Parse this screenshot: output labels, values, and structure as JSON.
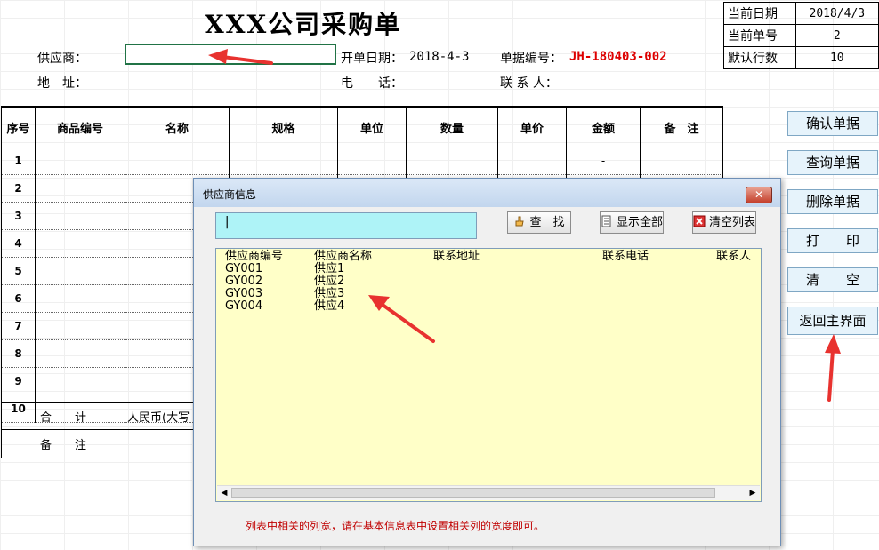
{
  "form": {
    "title": "XXX公司采购单",
    "supplier_label": "供应商：",
    "address_label": "地　址：",
    "date_label": "开单日期：",
    "date_value": "2018-4-3",
    "phone_label": "电　　话：",
    "orderno_label": "单据编号：",
    "orderno_value": "JH-180403-002",
    "contact_label": "联 系 人："
  },
  "info": [
    {
      "k": "当前日期",
      "v": "2018/4/3"
    },
    {
      "k": "当前单号",
      "v": "2"
    },
    {
      "k": "默认行数",
      "v": "10"
    }
  ],
  "table": {
    "headers": [
      "序号",
      "商品编号",
      "名称",
      "规格",
      "单位",
      "数量",
      "单价",
      "金额",
      "备　注"
    ],
    "rows": [
      "1",
      "2",
      "3",
      "4",
      "5",
      "6",
      "7",
      "8",
      "9",
      "10"
    ],
    "first_amount": "-",
    "total_label": "合　　计",
    "total_value": "人民币(大写",
    "remark_label": "备　　注"
  },
  "side_buttons": [
    "确认单据",
    "查询单据",
    "删除单据",
    "打　　印",
    "清　　空",
    "返回主界面"
  ],
  "dialog": {
    "title": "供应商信息",
    "close": "✕",
    "search_value": "|",
    "find_label": "查　找",
    "show_all_label": "显示全部",
    "clear_label": "清空列表",
    "columns": [
      "供应商编号",
      "供应商名称",
      "联系地址",
      "联系电话",
      "联系人"
    ],
    "rows": [
      {
        "id": "GY001",
        "name": "供应1"
      },
      {
        "id": "GY002",
        "name": "供应2"
      },
      {
        "id": "GY003",
        "name": "供应3"
      },
      {
        "id": "GY004",
        "name": "供应4"
      }
    ],
    "note": "列表中相关的列宽，请在基本信息表中设置相关列的宽度即可。"
  },
  "colors": {
    "accent_red": "#d00000",
    "input_cyan": "#aef3f7",
    "list_yellow": "#ffffc8",
    "button_blue": "#e6f3fb"
  }
}
